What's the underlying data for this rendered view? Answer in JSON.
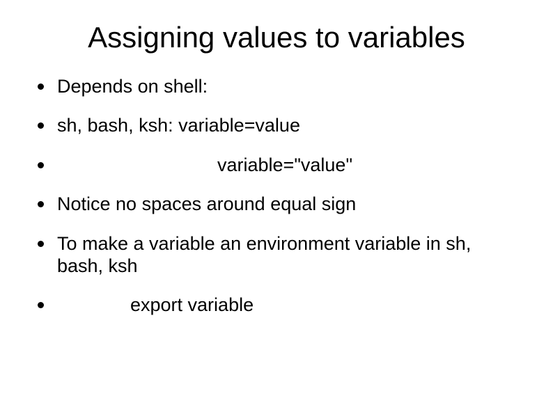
{
  "title": "Assigning values to variables",
  "items": [
    {
      "text": "Depends on shell:",
      "indentClass": ""
    },
    {
      "text": "sh, bash, ksh:  variable=value",
      "indentClass": ""
    },
    {
      "text": "variable=\"value\"",
      "indentClass": "text-indent-a"
    },
    {
      "text": "Notice no spaces around equal sign",
      "indentClass": ""
    },
    {
      "text": "To make a variable an environment variable in sh, bash, ksh",
      "indentClass": ""
    },
    {
      "text": "export variable",
      "indentClass": "text-indent-b"
    }
  ]
}
